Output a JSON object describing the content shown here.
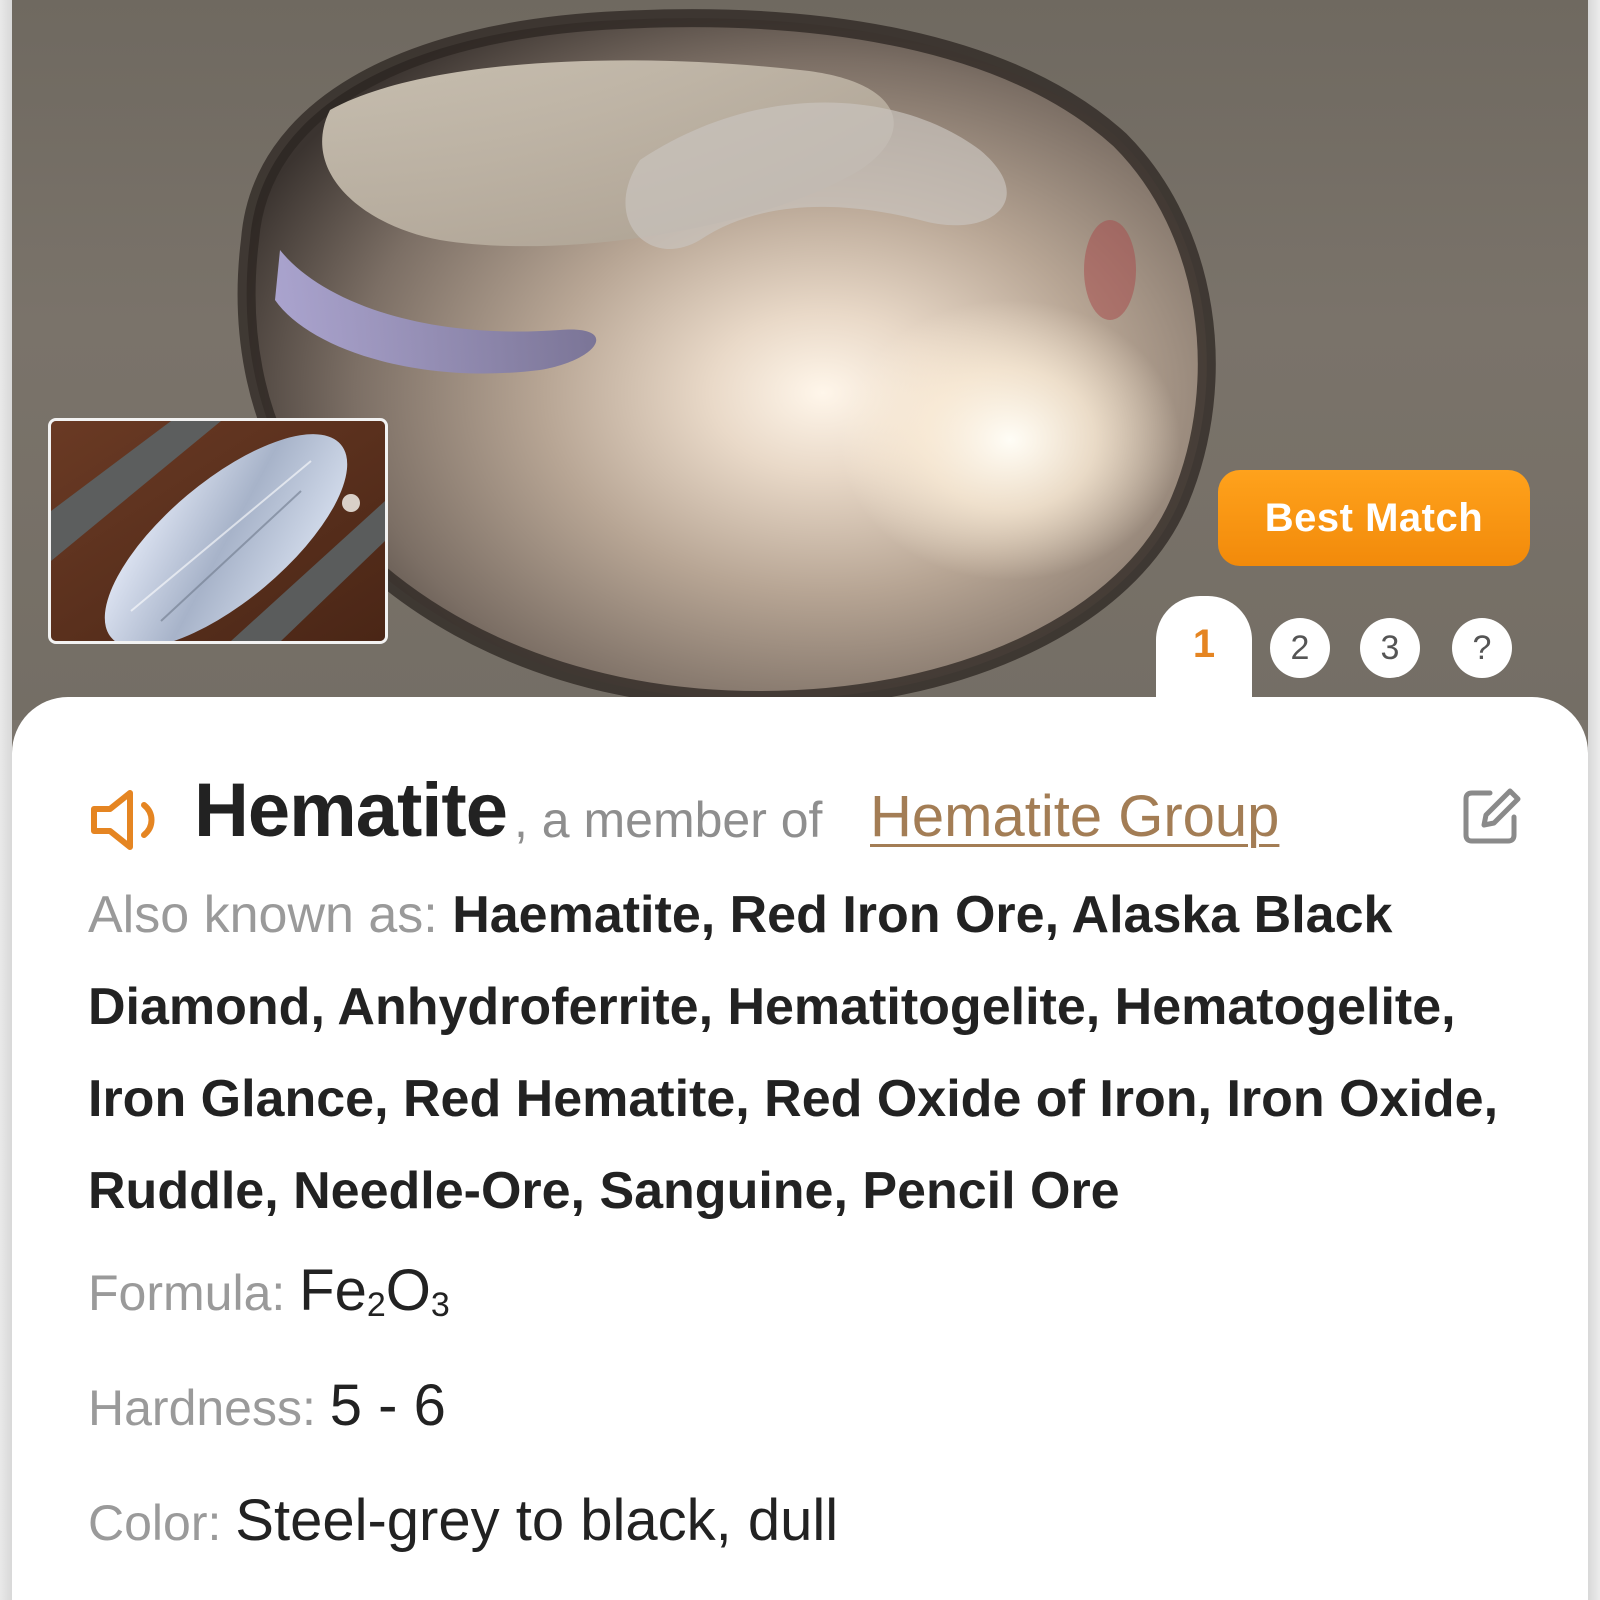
{
  "badge": {
    "label": "Best Match",
    "color": "#f28a0a"
  },
  "tabs": {
    "active": "1",
    "items": [
      "1",
      "2",
      "3",
      "?"
    ]
  },
  "thumbnail": {
    "icon": "user-photo-thumbnail"
  },
  "header": {
    "name": "Hematite",
    "member_prefix": ", a member of ",
    "group_link": "Hematite Group",
    "speaker_icon": "speaker-icon",
    "edit_icon": "edit-icon"
  },
  "details": {
    "aka_label": "Also known as: ",
    "aka_values": "Haematite, Red Iron Ore, Alaska Black Diamond, Anhydroferrite, Hematitogelite, Hematogelite, Iron Glance, Red Hematite, Red Oxide of Iron, Iron Oxide, Ruddle, Needle-Ore, Sanguine, Pencil Ore",
    "formula_label": "Formula: ",
    "formula_parts": [
      "Fe",
      "2",
      "O",
      "3"
    ],
    "hardness_label": "Hardness: ",
    "hardness_value": "5 - 6",
    "color_label": "Color: ",
    "color_value": "Steel-grey to black, dull"
  },
  "colors": {
    "accent": "#e58522",
    "link": "#a37d55",
    "label_grey": "#9a9a9a",
    "text": "#222222"
  }
}
